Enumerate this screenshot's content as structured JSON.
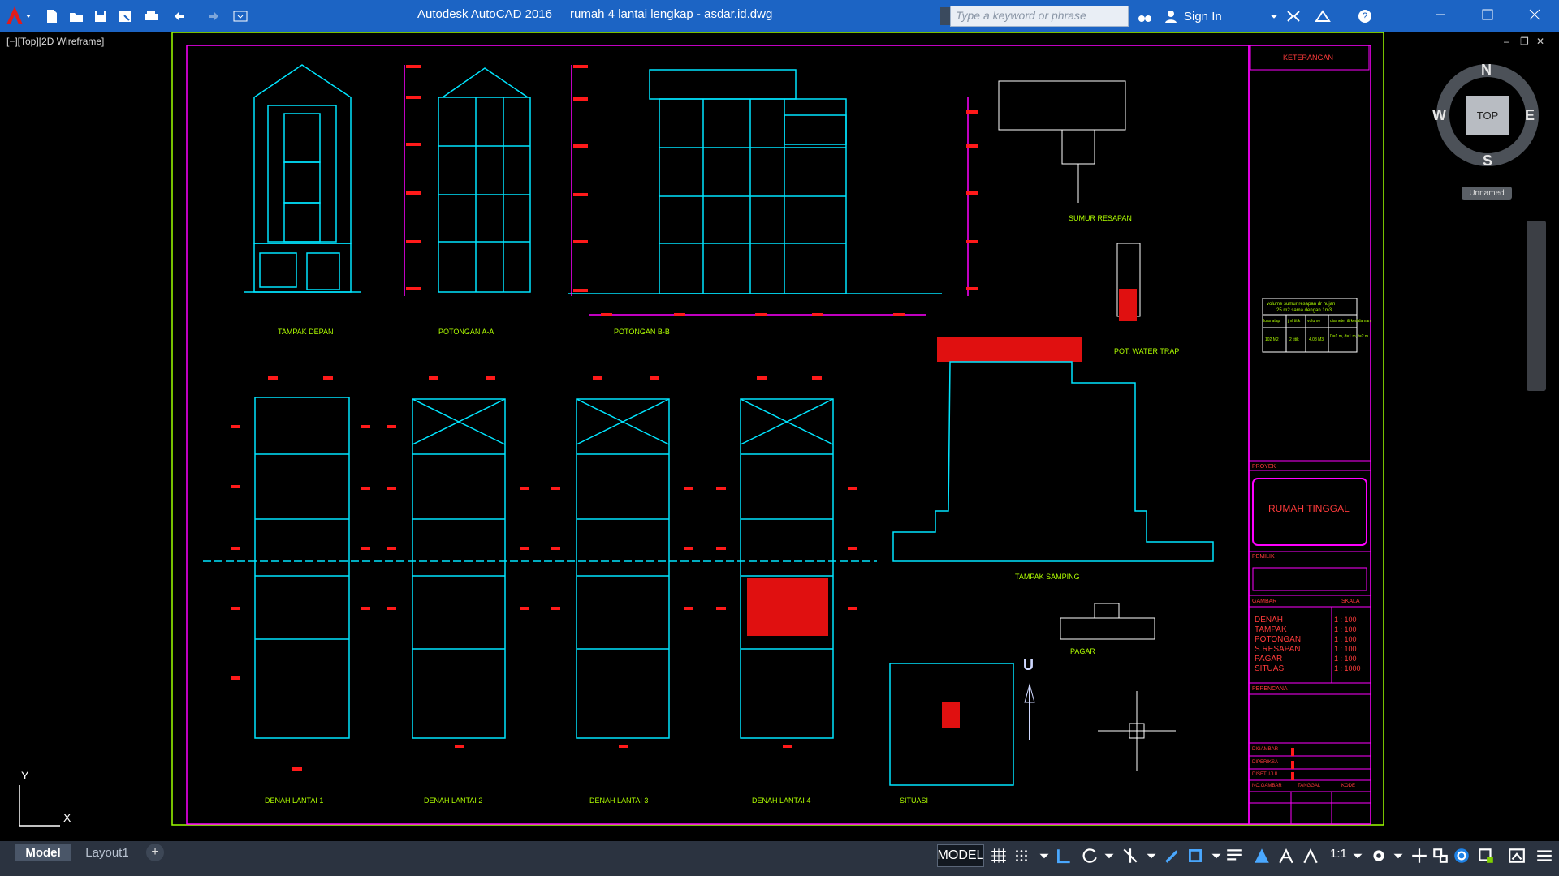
{
  "app": {
    "title": "Autodesk AutoCAD 2016",
    "filename": "rumah 4 lantai lengkap - asdar.id.dwg",
    "search_placeholder": "Type a keyword or phrase",
    "sign_in": "Sign In"
  },
  "viewport": {
    "label": "[−][Top][2D Wireframe]",
    "controls": {
      "min": "–",
      "restore": "❐",
      "close": "✕"
    }
  },
  "viewcube": {
    "top": "TOP",
    "north": "N",
    "south": "S",
    "east": "E",
    "west": "W",
    "ucs_name": "Unnamed"
  },
  "ucs": {
    "y_label": "Y",
    "x_label": "X"
  },
  "drawing": {
    "labels": {
      "tampak_depan": "TAMPAK DEPAN",
      "potongan_aa": "POTONGAN A-A",
      "potongan_bb": "POTONGAN B-B",
      "sumur_resapan": "SUMUR RESAPAN",
      "pot_water_trap": "POT. WATER TRAP",
      "tampak_samping": "TAMPAK SAMPING",
      "pagar": "PAGAR",
      "denah_lantai_1": "DENAH LANTAI 1",
      "denah_lantai_2": "DENAH LANTAI 2",
      "denah_lantai_3": "DENAH LANTAI 3",
      "denah_lantai_4": "DENAH LANTAI 4",
      "situasi": "SITUASI",
      "north_letter": "U"
    },
    "water_table": {
      "caption": "volume sumur resapan dr hujan",
      "caption2": "25 m2 sama dengan 1m3",
      "headers": [
        "luas atap",
        "jml titik",
        "volume",
        "diameter & kedalaman"
      ],
      "row": [
        "102 M2",
        "2 titik",
        "4.08 M3",
        "D=1 m, d=1 m, t=2 m"
      ]
    },
    "title_block": {
      "keterangan": "KETERANGAN",
      "proyek": "PROYEK",
      "project_name": "RUMAH TINGGAL",
      "pemilik": "PEMILIK",
      "gambar": "GAMBAR",
      "skala": "SKALA",
      "items": [
        {
          "name": "DENAH",
          "scale": "1 : 100"
        },
        {
          "name": "TAMPAK",
          "scale": "1 : 100"
        },
        {
          "name": "POTONGAN",
          "scale": "1 : 100"
        },
        {
          "name": "S.RESAPAN",
          "scale": "1 : 100"
        },
        {
          "name": "PAGAR",
          "scale": "1 : 100"
        },
        {
          "name": "SITUASI",
          "scale": "1 : 1000"
        }
      ],
      "perencana": "PERENCANA",
      "digambar": "DIGAMBAR",
      "diperiksa": "DIPERIKSA",
      "disetujui": "DISETUJUI",
      "no_gambar": "NO.GAMBAR",
      "tanggal": "TANGGAL",
      "kode": "KODE"
    }
  },
  "layout_tabs": {
    "model": "Model",
    "layout1": "Layout1",
    "add": "+"
  },
  "status": {
    "model": "MODEL",
    "scale": "1:1"
  },
  "colors": {
    "cyan": "#00e5ff",
    "magenta": "#ff00ff",
    "red": "#ff1a1a",
    "green": "#b0ff00",
    "frame_green": "#9dff00",
    "titlebar": "#1c64c4"
  }
}
